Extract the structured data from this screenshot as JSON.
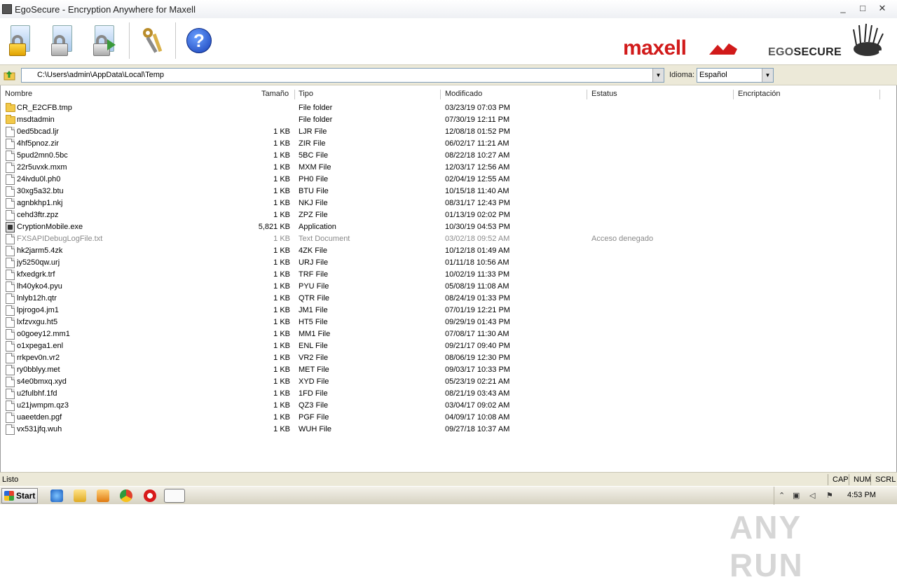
{
  "window": {
    "title": "EgoSecure - Encryption Anywhere for Maxell",
    "controls": [
      "_",
      "□",
      "✕"
    ]
  },
  "toolbar": {
    "buttons": [
      {
        "name": "encrypt",
        "icon": "lock-yellow-icon"
      },
      {
        "name": "decrypt",
        "icon": "lock-grey-icon"
      },
      {
        "name": "export",
        "icon": "lock-export-icon"
      },
      {
        "name": "keys",
        "icon": "keys-icon"
      },
      {
        "name": "help",
        "icon": "help-icon",
        "glyph": "?"
      }
    ],
    "brand_maxell": "maxell",
    "brand_ego_1": "EGO",
    "brand_ego_2": "SECURE",
    "brand_color": "#d11a1a"
  },
  "address": {
    "path": "C:\\Users\\admin\\AppData\\Local\\Temp",
    "language_label": "Idioma:",
    "language_value": "Español"
  },
  "columns": [
    "Nombre",
    "Tamaño",
    "Tipo",
    "Modificado",
    "Estatus",
    "Encriptación"
  ],
  "files": [
    {
      "icon": "folder",
      "name": "CR_E2CFB.tmp",
      "size": "",
      "type": "File folder",
      "modified": "03/23/19 07:03 PM",
      "status": "",
      "enc": ""
    },
    {
      "icon": "folder",
      "name": "msdtadmin",
      "size": "",
      "type": "File folder",
      "modified": "07/30/19 12:11 PM",
      "status": "",
      "enc": ""
    },
    {
      "icon": "file",
      "name": "0ed5bcad.ljr",
      "size": "1 KB",
      "type": "LJR File",
      "modified": "12/08/18 01:52 PM",
      "status": "",
      "enc": ""
    },
    {
      "icon": "file",
      "name": "4hf5pnoz.zir",
      "size": "1 KB",
      "type": "ZIR File",
      "modified": "06/02/17 11:21 AM",
      "status": "",
      "enc": ""
    },
    {
      "icon": "file",
      "name": "5pud2mn0.5bc",
      "size": "1 KB",
      "type": "5BC File",
      "modified": "08/22/18 10:27 AM",
      "status": "",
      "enc": ""
    },
    {
      "icon": "file",
      "name": "22r5uvxk.mxm",
      "size": "1 KB",
      "type": "MXM File",
      "modified": "12/03/17 12:56 AM",
      "status": "",
      "enc": ""
    },
    {
      "icon": "file",
      "name": "24ivdu0l.ph0",
      "size": "1 KB",
      "type": "PH0 File",
      "modified": "02/04/19 12:55 AM",
      "status": "",
      "enc": ""
    },
    {
      "icon": "file",
      "name": "30xg5a32.btu",
      "size": "1 KB",
      "type": "BTU File",
      "modified": "10/15/18 11:40 AM",
      "status": "",
      "enc": ""
    },
    {
      "icon": "file",
      "name": "agnbkhp1.nkj",
      "size": "1 KB",
      "type": "NKJ File",
      "modified": "08/31/17 12:43 PM",
      "status": "",
      "enc": ""
    },
    {
      "icon": "file",
      "name": "cehd3ftr.zpz",
      "size": "1 KB",
      "type": "ZPZ File",
      "modified": "01/13/19 02:02 PM",
      "status": "",
      "enc": ""
    },
    {
      "icon": "app",
      "name": "CryptionMobile.exe",
      "size": "5,821 KB",
      "type": "Application",
      "modified": "10/30/19 04:53 PM",
      "status": "",
      "enc": ""
    },
    {
      "icon": "file",
      "name": "FXSAPIDebugLogFile.txt",
      "size": "1 KB",
      "type": "Text Document",
      "modified": "03/02/18 09:52 AM",
      "status": "Acceso denegado",
      "enc": "",
      "grey": true
    },
    {
      "icon": "file",
      "name": "hk2jarm5.4zk",
      "size": "1 KB",
      "type": "4ZK File",
      "modified": "10/12/18 01:49 AM",
      "status": "",
      "enc": ""
    },
    {
      "icon": "file",
      "name": "jy5250qw.urj",
      "size": "1 KB",
      "type": "URJ File",
      "modified": "01/11/18 10:56 AM",
      "status": "",
      "enc": ""
    },
    {
      "icon": "file",
      "name": "kfxedgrk.trf",
      "size": "1 KB",
      "type": "TRF File",
      "modified": "10/02/19 11:33 PM",
      "status": "",
      "enc": ""
    },
    {
      "icon": "file",
      "name": "lh40yko4.pyu",
      "size": "1 KB",
      "type": "PYU File",
      "modified": "05/08/19 11:08 AM",
      "status": "",
      "enc": ""
    },
    {
      "icon": "file",
      "name": "lnlyb12h.qtr",
      "size": "1 KB",
      "type": "QTR File",
      "modified": "08/24/19 01:33 PM",
      "status": "",
      "enc": ""
    },
    {
      "icon": "file",
      "name": "lpjrogo4.jm1",
      "size": "1 KB",
      "type": "JM1 File",
      "modified": "07/01/19 12:21 PM",
      "status": "",
      "enc": ""
    },
    {
      "icon": "file",
      "name": "lxfzvxgu.ht5",
      "size": "1 KB",
      "type": "HT5 File",
      "modified": "09/29/19 01:43 PM",
      "status": "",
      "enc": ""
    },
    {
      "icon": "file",
      "name": "o0goey12.mm1",
      "size": "1 KB",
      "type": "MM1 File",
      "modified": "07/08/17 11:30 AM",
      "status": "",
      "enc": ""
    },
    {
      "icon": "file",
      "name": "o1xpega1.enl",
      "size": "1 KB",
      "type": "ENL File",
      "modified": "09/21/17 09:40 PM",
      "status": "",
      "enc": ""
    },
    {
      "icon": "file",
      "name": "rrkpev0n.vr2",
      "size": "1 KB",
      "type": "VR2 File",
      "modified": "08/06/19 12:30 PM",
      "status": "",
      "enc": ""
    },
    {
      "icon": "file",
      "name": "ry0bblyy.met",
      "size": "1 KB",
      "type": "MET File",
      "modified": "09/03/17 10:33 PM",
      "status": "",
      "enc": ""
    },
    {
      "icon": "file",
      "name": "s4e0bmxq.xyd",
      "size": "1 KB",
      "type": "XYD File",
      "modified": "05/23/19 02:21 AM",
      "status": "",
      "enc": ""
    },
    {
      "icon": "file",
      "name": "u2fulbhf.1fd",
      "size": "1 KB",
      "type": "1FD File",
      "modified": "08/21/19 03:43 AM",
      "status": "",
      "enc": ""
    },
    {
      "icon": "file",
      "name": "u21jwmpm.qz3",
      "size": "1 KB",
      "type": "QZ3 File",
      "modified": "03/04/17 09:02 AM",
      "status": "",
      "enc": ""
    },
    {
      "icon": "file",
      "name": "uaeetden.pgf",
      "size": "1 KB",
      "type": "PGF File",
      "modified": "04/09/17 10:08 AM",
      "status": "",
      "enc": ""
    },
    {
      "icon": "file",
      "name": "vx531jfq.wuh",
      "size": "1 KB",
      "type": "WUH File",
      "modified": "09/27/18 10:37 AM",
      "status": "",
      "enc": ""
    }
  ],
  "watermark": "ANY RUN",
  "status": {
    "message": "Listo",
    "indicators": [
      "CAP",
      "NUM",
      "SCRL"
    ]
  },
  "taskbar": {
    "start_label": "Start",
    "clock": "4:53 PM",
    "apps": [
      "ie-icon",
      "folder-icon",
      "media-player-icon",
      "chrome-icon",
      "opera-icon",
      "egosecure-icon"
    ]
  }
}
